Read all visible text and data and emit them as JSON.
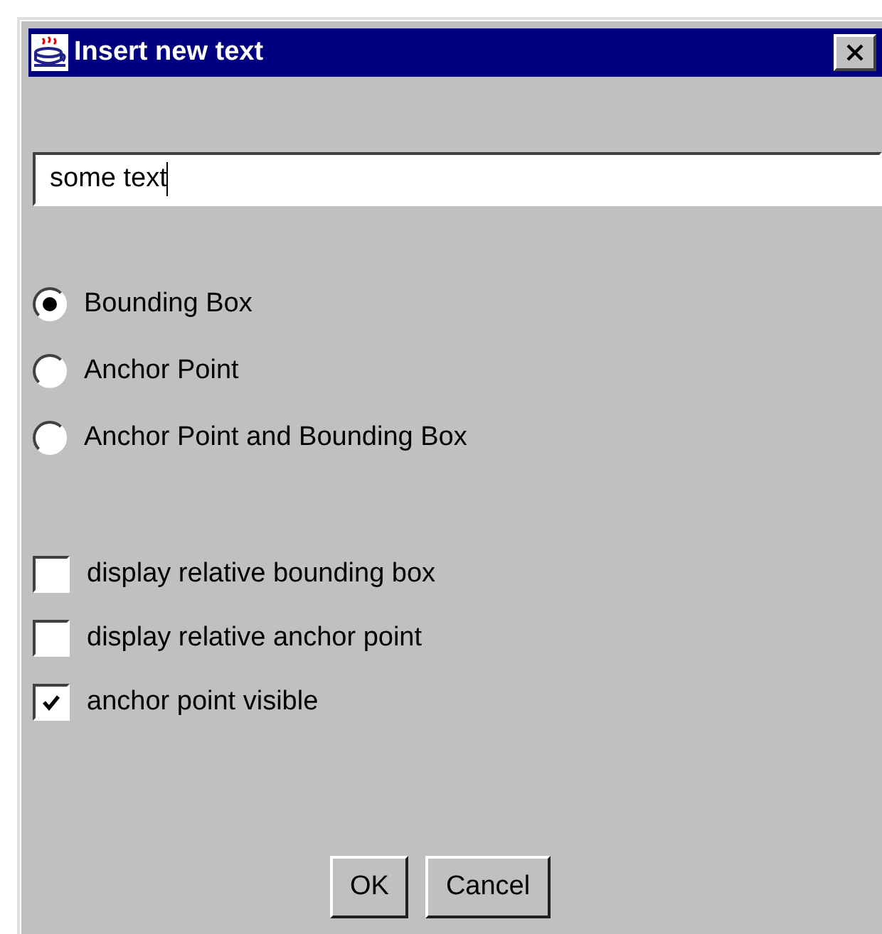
{
  "window": {
    "title": "Insert new text"
  },
  "text_field": {
    "value": "some text"
  },
  "radios": [
    {
      "label": "Bounding Box",
      "selected": true
    },
    {
      "label": "Anchor Point",
      "selected": false
    },
    {
      "label": "Anchor Point and Bounding Box",
      "selected": false
    }
  ],
  "checkboxes": [
    {
      "label": "display relative bounding box",
      "checked": false
    },
    {
      "label": "display relative anchor point",
      "checked": false
    },
    {
      "label": "anchor point visible",
      "checked": true
    }
  ],
  "buttons": [
    "OK",
    "Cancel"
  ]
}
